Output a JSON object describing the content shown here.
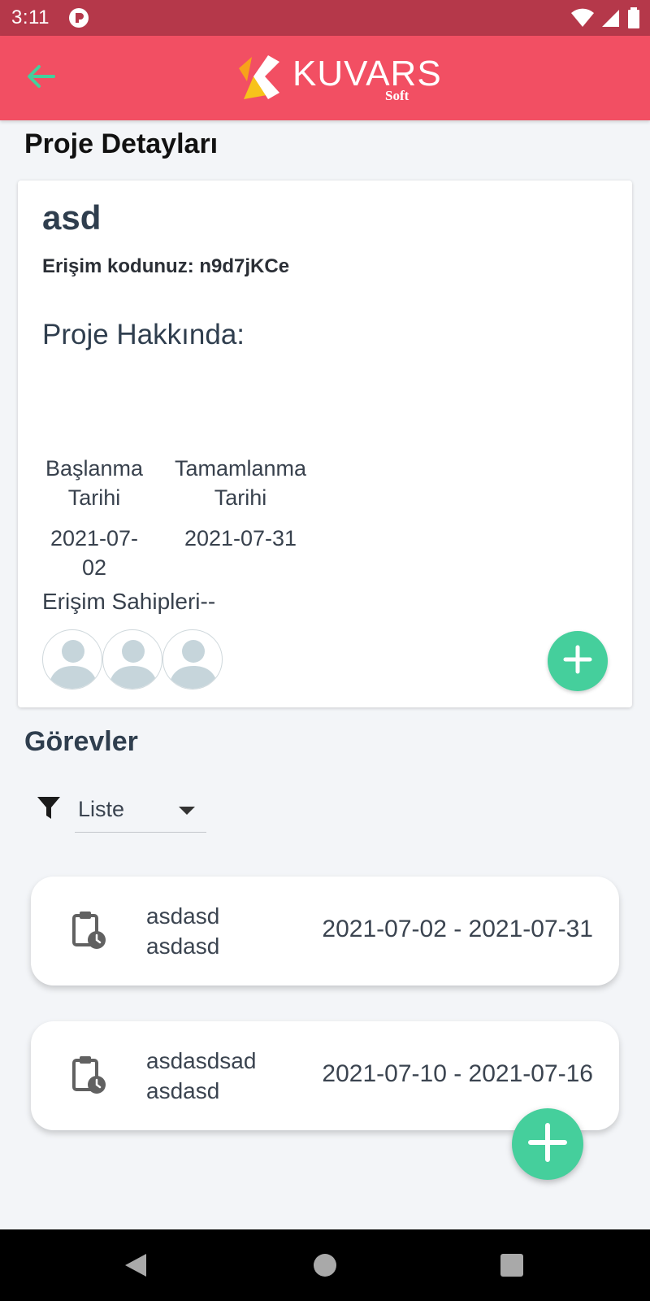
{
  "status_bar": {
    "time": "3:11",
    "icons": [
      "app-notification-icon",
      "wifi-icon",
      "signal-icon",
      "battery-icon"
    ]
  },
  "app_bar": {
    "back_icon": "arrow-left-icon",
    "logo_text": "KUVARS",
    "logo_subtext": "Soft"
  },
  "page": {
    "title": "Proje Detayları"
  },
  "project": {
    "name": "asd",
    "access_code": "Erişim kodunuz: n9d7jKCe",
    "about_label": "Proje Hakkında:",
    "about_text": "",
    "start_label": "Başlanma\nTarihi",
    "start_date": "2021-07-02",
    "end_label": "Tamamlanma\nTarihi",
    "end_date": "2021-07-31",
    "owners_label": "Erişim Sahipleri--",
    "owners": [
      "avatar",
      "avatar",
      "avatar"
    ]
  },
  "tasks": {
    "title": "Görevler",
    "filter_value": "Liste",
    "items": [
      {
        "line1": "asdasd",
        "line2": "asdasd",
        "dates": "2021-07-02 - 2021-07-31"
      },
      {
        "line1": "asdasdsad",
        "line2": "asdasd",
        "dates": "2021-07-10 - 2021-07-16"
      }
    ]
  },
  "colors": {
    "status_bar": "#b5384a",
    "app_bar": "#f24f63",
    "accent_green": "#45cf9c",
    "back_arrow": "#45cf9c"
  }
}
